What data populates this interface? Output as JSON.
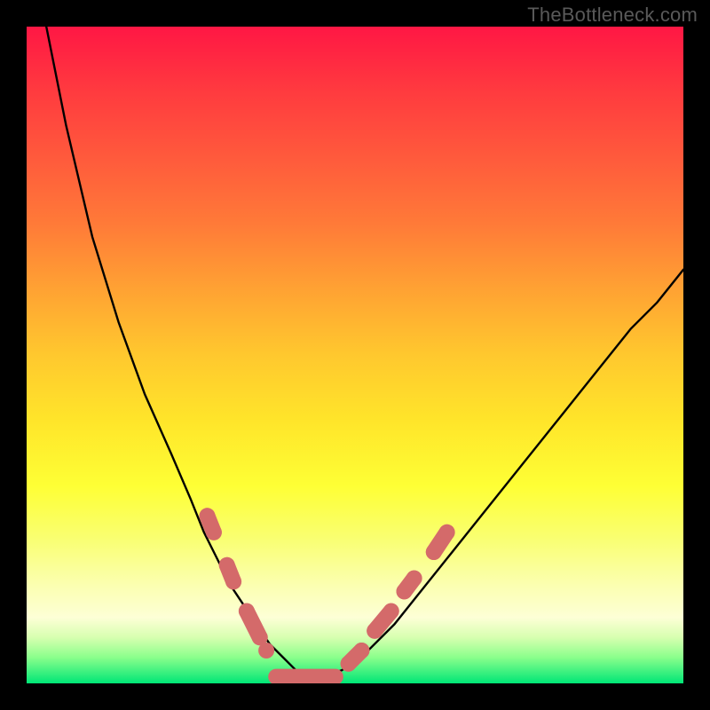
{
  "watermark": "TheBottleneck.com",
  "colors": {
    "frame": "#000000",
    "curve": "#000000",
    "marker_fill": "#d46a6a",
    "marker_stroke": "#d46a6a",
    "gradient_top": "#ff1744",
    "gradient_bottom": "#00e676"
  },
  "chart_data": {
    "type": "line",
    "title": "",
    "xlabel": "",
    "ylabel": "",
    "xlim": [
      0,
      100
    ],
    "ylim": [
      0,
      100
    ],
    "grid": false,
    "legend": false,
    "series": [
      {
        "name": "bottleneck-curve",
        "x": [
          3,
          6,
          10,
          14,
          18,
          22,
          25,
          27,
          29,
          31,
          33,
          35,
          37,
          39,
          41,
          43,
          45,
          48,
          52,
          56,
          60,
          64,
          68,
          72,
          76,
          80,
          84,
          88,
          92,
          96,
          100
        ],
        "y": [
          100,
          85,
          68,
          55,
          44,
          35,
          28,
          23,
          19,
          15,
          12,
          9,
          6,
          4,
          2,
          1,
          1,
          2,
          5,
          9,
          14,
          19,
          24,
          29,
          34,
          39,
          44,
          49,
          54,
          58,
          63
        ]
      }
    ],
    "markers": {
      "left_branch": [
        {
          "x": 27.5,
          "y": 25.5
        },
        {
          "x": 28.5,
          "y": 23
        },
        {
          "x": 30.5,
          "y": 18
        },
        {
          "x": 31.5,
          "y": 15.5
        },
        {
          "x": 33.5,
          "y": 11
        },
        {
          "x": 35.5,
          "y": 7
        },
        {
          "x": 36.5,
          "y": 5
        }
      ],
      "bottom_bar": {
        "x_start": 38,
        "x_end": 47,
        "y": 1
      },
      "right_branch": [
        {
          "x": 49,
          "y": 3
        },
        {
          "x": 51,
          "y": 5
        },
        {
          "x": 53,
          "y": 8
        },
        {
          "x": 55.5,
          "y": 11
        },
        {
          "x": 57.5,
          "y": 14
        },
        {
          "x": 59,
          "y": 16
        },
        {
          "x": 62,
          "y": 20
        },
        {
          "x": 64,
          "y": 23
        }
      ]
    }
  }
}
